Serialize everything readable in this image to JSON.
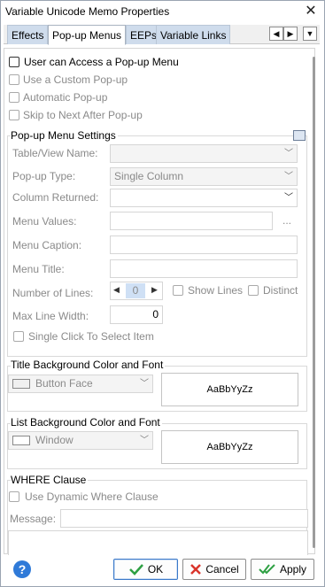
{
  "window": {
    "title": "Variable Unicode Memo Properties"
  },
  "tabs": [
    {
      "label": "Effects",
      "active": false
    },
    {
      "label": "Pop-up Menus",
      "active": true
    },
    {
      "label": "EEPs",
      "active": false
    },
    {
      "label": "Variable Links",
      "active": false
    }
  ],
  "tab_scroll": {
    "left": "◀",
    "right": "▶",
    "menu": "▼"
  },
  "options": {
    "user_access": "User can Access a Pop-up Menu",
    "custom_popup": "Use a Custom Pop-up",
    "automatic_popup": "Automatic Pop-up",
    "skip_next": "Skip to Next After Pop-up"
  },
  "popup_settings": {
    "title": "Pop-up Menu Settings",
    "table_view_label": "Table/View Name:",
    "table_view_value": "",
    "popup_type_label": "Pop-up Type:",
    "popup_type_value": "Single Column",
    "column_returned_label": "Column Returned:",
    "column_returned_value": "",
    "menu_values_label": "Menu Values:",
    "menu_values_button": "...",
    "menu_caption_label": "Menu Caption:",
    "menu_title_label": "Menu Title:",
    "number_lines_label": "Number of Lines:",
    "number_lines_value": "0",
    "show_lines": "Show Lines",
    "distinct": "Distinct",
    "max_line_width_label": "Max Line Width:",
    "max_line_width_value": "0",
    "single_click": "Single Click To Select Item"
  },
  "title_bg": {
    "title": "Title Background Color and Font",
    "color_value": "Button Face",
    "preview_text": "AaBbYyZz"
  },
  "list_bg": {
    "title": "List Background Color and Font",
    "color_value": "Window",
    "preview_text": "AaBbYyZz"
  },
  "where": {
    "title": "WHERE Clause",
    "dynamic": "Use Dynamic Where Clause",
    "message_label": "Message:"
  },
  "footer": {
    "help": "?",
    "ok": "OK",
    "cancel": "Cancel",
    "apply": "Apply"
  },
  "colors": {
    "tab_inactive": "#cfdcec",
    "accent": "#2f7ad8",
    "ok_check": "#2ea043",
    "cancel_x": "#d9342b"
  }
}
